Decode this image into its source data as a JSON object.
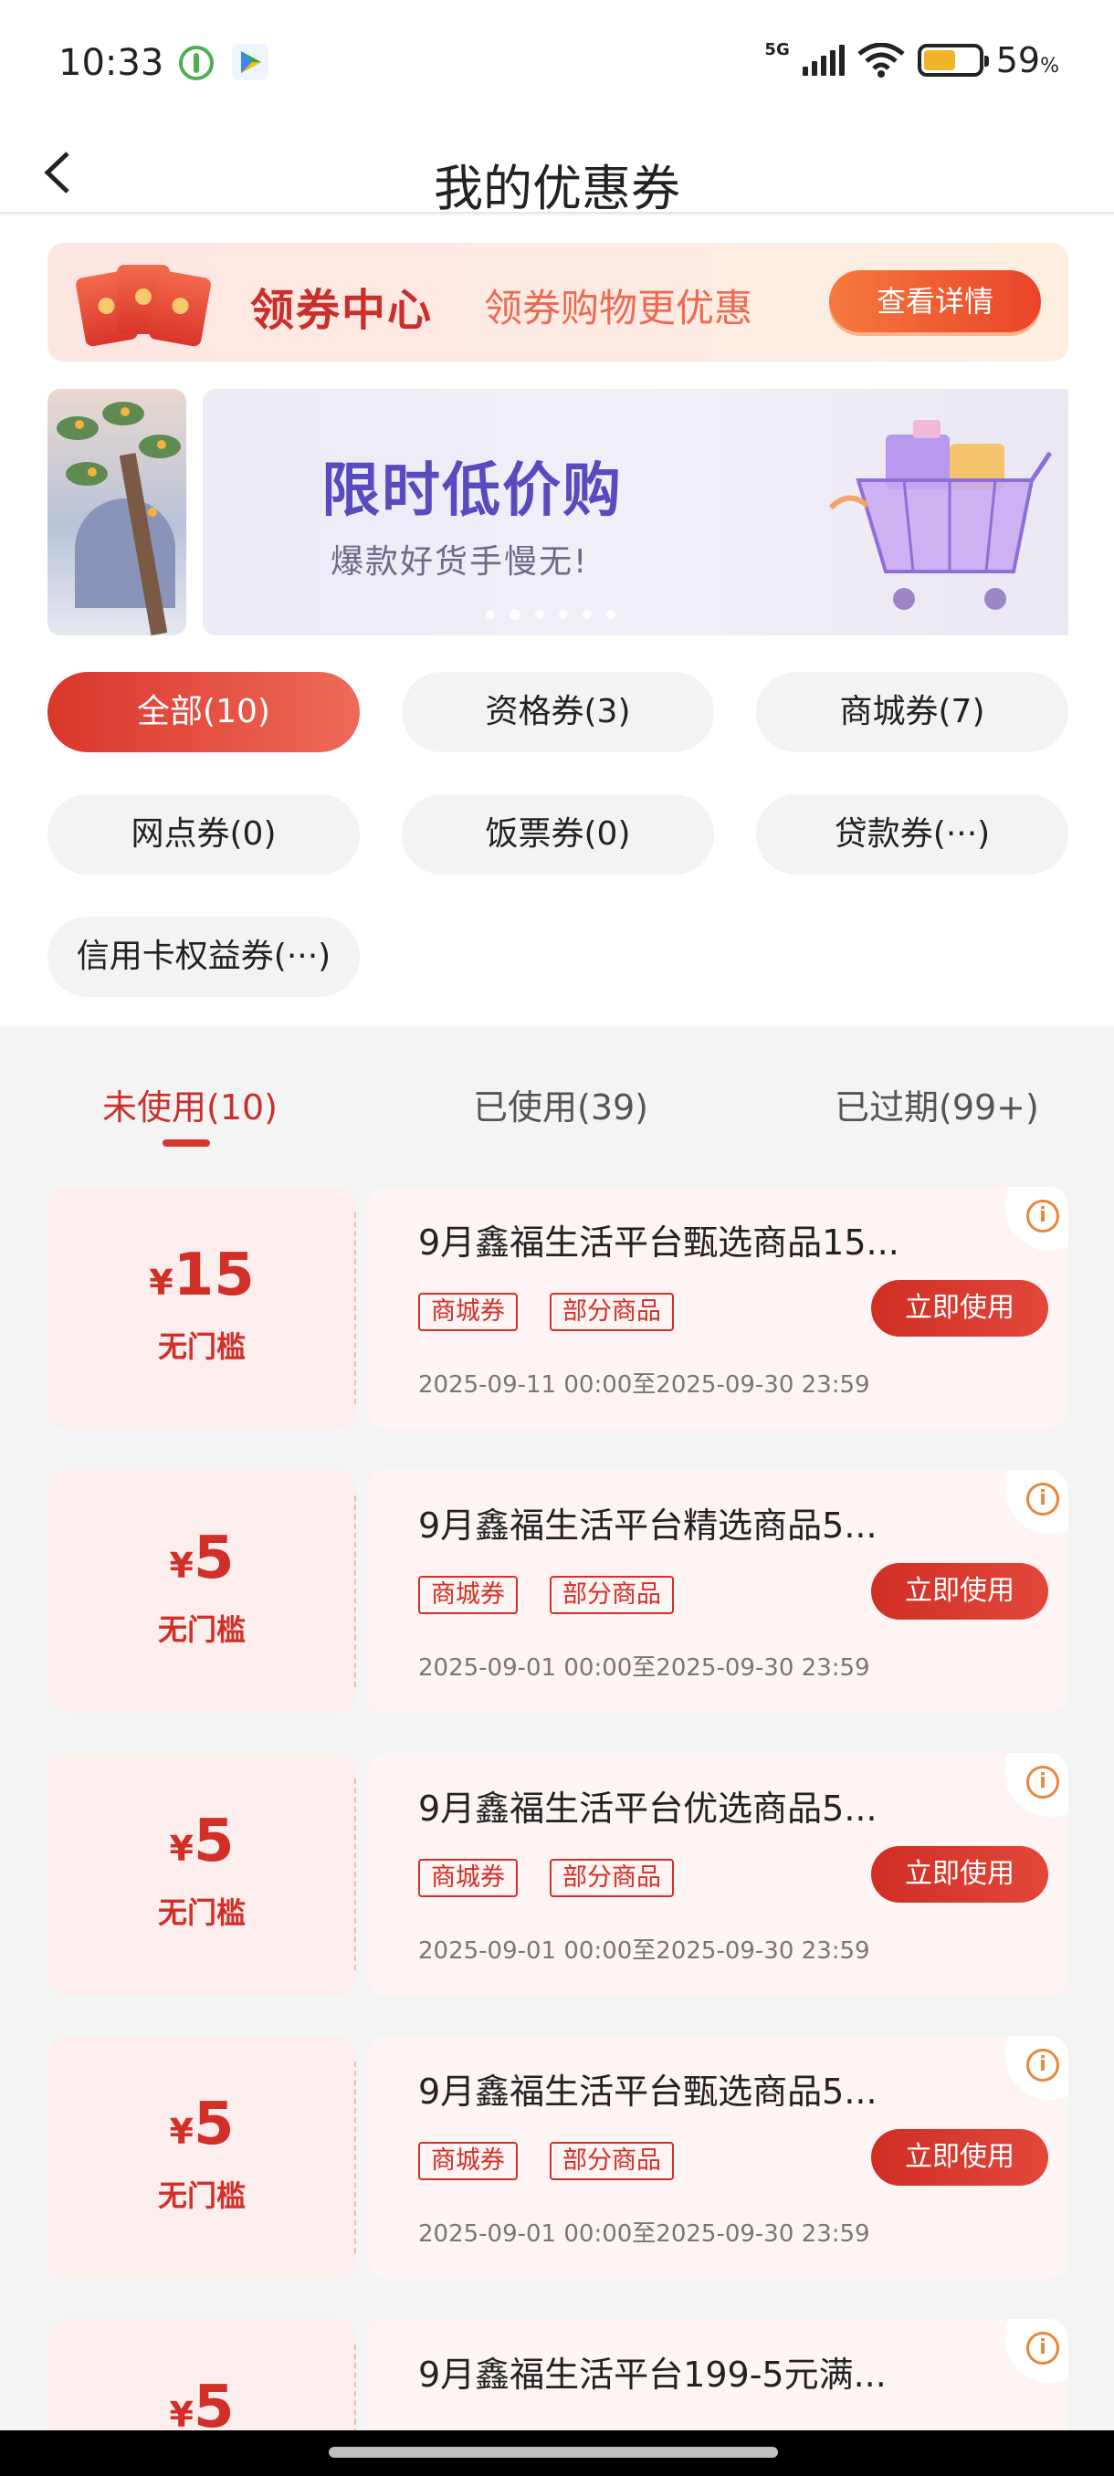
{
  "status_bar": {
    "time": "10:33",
    "network": "5G",
    "battery_percent": "59",
    "battery_unit": "%",
    "battery_level": 0.59
  },
  "header": {
    "title": "我的优惠券",
    "back_icon": "chevron-left-icon"
  },
  "coupon_center": {
    "title": "领券中心",
    "subtitle": "领券购物更优惠",
    "button_label": "查看详情"
  },
  "promo": {
    "title": "限时低价购",
    "subtitle": "爆款好货手慢无!",
    "dots_count": 6,
    "active_dot": 1
  },
  "filters": [
    {
      "label": "全部(10)",
      "active": true
    },
    {
      "label": "资格券(3)",
      "active": false
    },
    {
      "label": "商城券(7)",
      "active": false
    },
    {
      "label": "网点券(0)",
      "active": false
    },
    {
      "label": "饭票券(0)",
      "active": false
    },
    {
      "label": "贷款券(···)",
      "active": false
    },
    {
      "label": "信用卡权益券(···)",
      "active": false
    }
  ],
  "tabs": [
    {
      "label": "未使用(10)",
      "active": true
    },
    {
      "label": "已使用(39)",
      "active": false
    },
    {
      "label": "已过期(99+)",
      "active": false
    }
  ],
  "coupons": [
    {
      "currency": "¥",
      "amount": "15",
      "threshold": "无门槛",
      "title": "9月鑫福生活平台甄选商品15...",
      "tags": [
        "商城券",
        "部分商品"
      ],
      "button": "立即使用",
      "date": "2025-09-11 00:00至2025-09-30 23:59"
    },
    {
      "currency": "¥",
      "amount": "5",
      "threshold": "无门槛",
      "title": "9月鑫福生活平台精选商品5...",
      "tags": [
        "商城券",
        "部分商品"
      ],
      "button": "立即使用",
      "date": "2025-09-01 00:00至2025-09-30 23:59"
    },
    {
      "currency": "¥",
      "amount": "5",
      "threshold": "无门槛",
      "title": "9月鑫福生活平台优选商品5...",
      "tags": [
        "商城券",
        "部分商品"
      ],
      "button": "立即使用",
      "date": "2025-09-01 00:00至2025-09-30 23:59"
    },
    {
      "currency": "¥",
      "amount": "5",
      "threshold": "无门槛",
      "title": "9月鑫福生活平台甄选商品5...",
      "tags": [
        "商城券",
        "部分商品"
      ],
      "button": "立即使用",
      "date": "2025-09-01 00:00至2025-09-30 23:59"
    },
    {
      "currency": "¥",
      "amount": "5",
      "threshold": "",
      "title": "9月鑫福生活平台199-5元满...",
      "tags": [
        "",
        ""
      ],
      "button": "",
      "date": ""
    }
  ],
  "colors": {
    "accent": "#d12f27",
    "tab_active": "#c9302c",
    "banner_button": "#e9442a"
  }
}
